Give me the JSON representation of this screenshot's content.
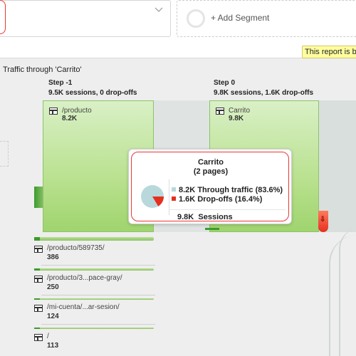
{
  "segments": {
    "add_segment_label": "+ Add Segment",
    "notice_text": "This report is b"
  },
  "report": {
    "title": "Traffic through 'Carrito'"
  },
  "steps": [
    {
      "name": "Step -1",
      "summary": "9.5K sessions, 0 drop-offs"
    },
    {
      "name": "Step 0",
      "summary": "9.8K sessions, 1.6K drop-offs"
    }
  ],
  "nodes": {
    "producto": {
      "name": "/producto",
      "count": "8.2K"
    },
    "carrito": {
      "name": "Carrito",
      "count": "9.8K"
    }
  },
  "mini_nodes": [
    {
      "name": "/producto/589735/",
      "count": "386"
    },
    {
      "name": "/producto/3...pace-gray/",
      "count": "250"
    },
    {
      "name": "/mi-cuenta/...ar-sesion/",
      "count": "124"
    },
    {
      "name": "/",
      "count": "113"
    }
  ],
  "tooltip": {
    "title": "Carrito",
    "subtitle": "(2 pages)",
    "through_value": "8.2K",
    "through_label": "Through traffic (83.6%)",
    "through_fraction": 0.836,
    "dropoff_value": "1.6K",
    "dropoff_label": "Drop-offs (16.4%)",
    "dropoff_fraction": 0.164,
    "sessions_value": "9.8K",
    "sessions_label": "Sessions"
  },
  "colors": {
    "through": "#b9d8dc",
    "dropoff": "#e53020",
    "node_green": "#b9e18f",
    "highlight_red": "#e53935"
  }
}
